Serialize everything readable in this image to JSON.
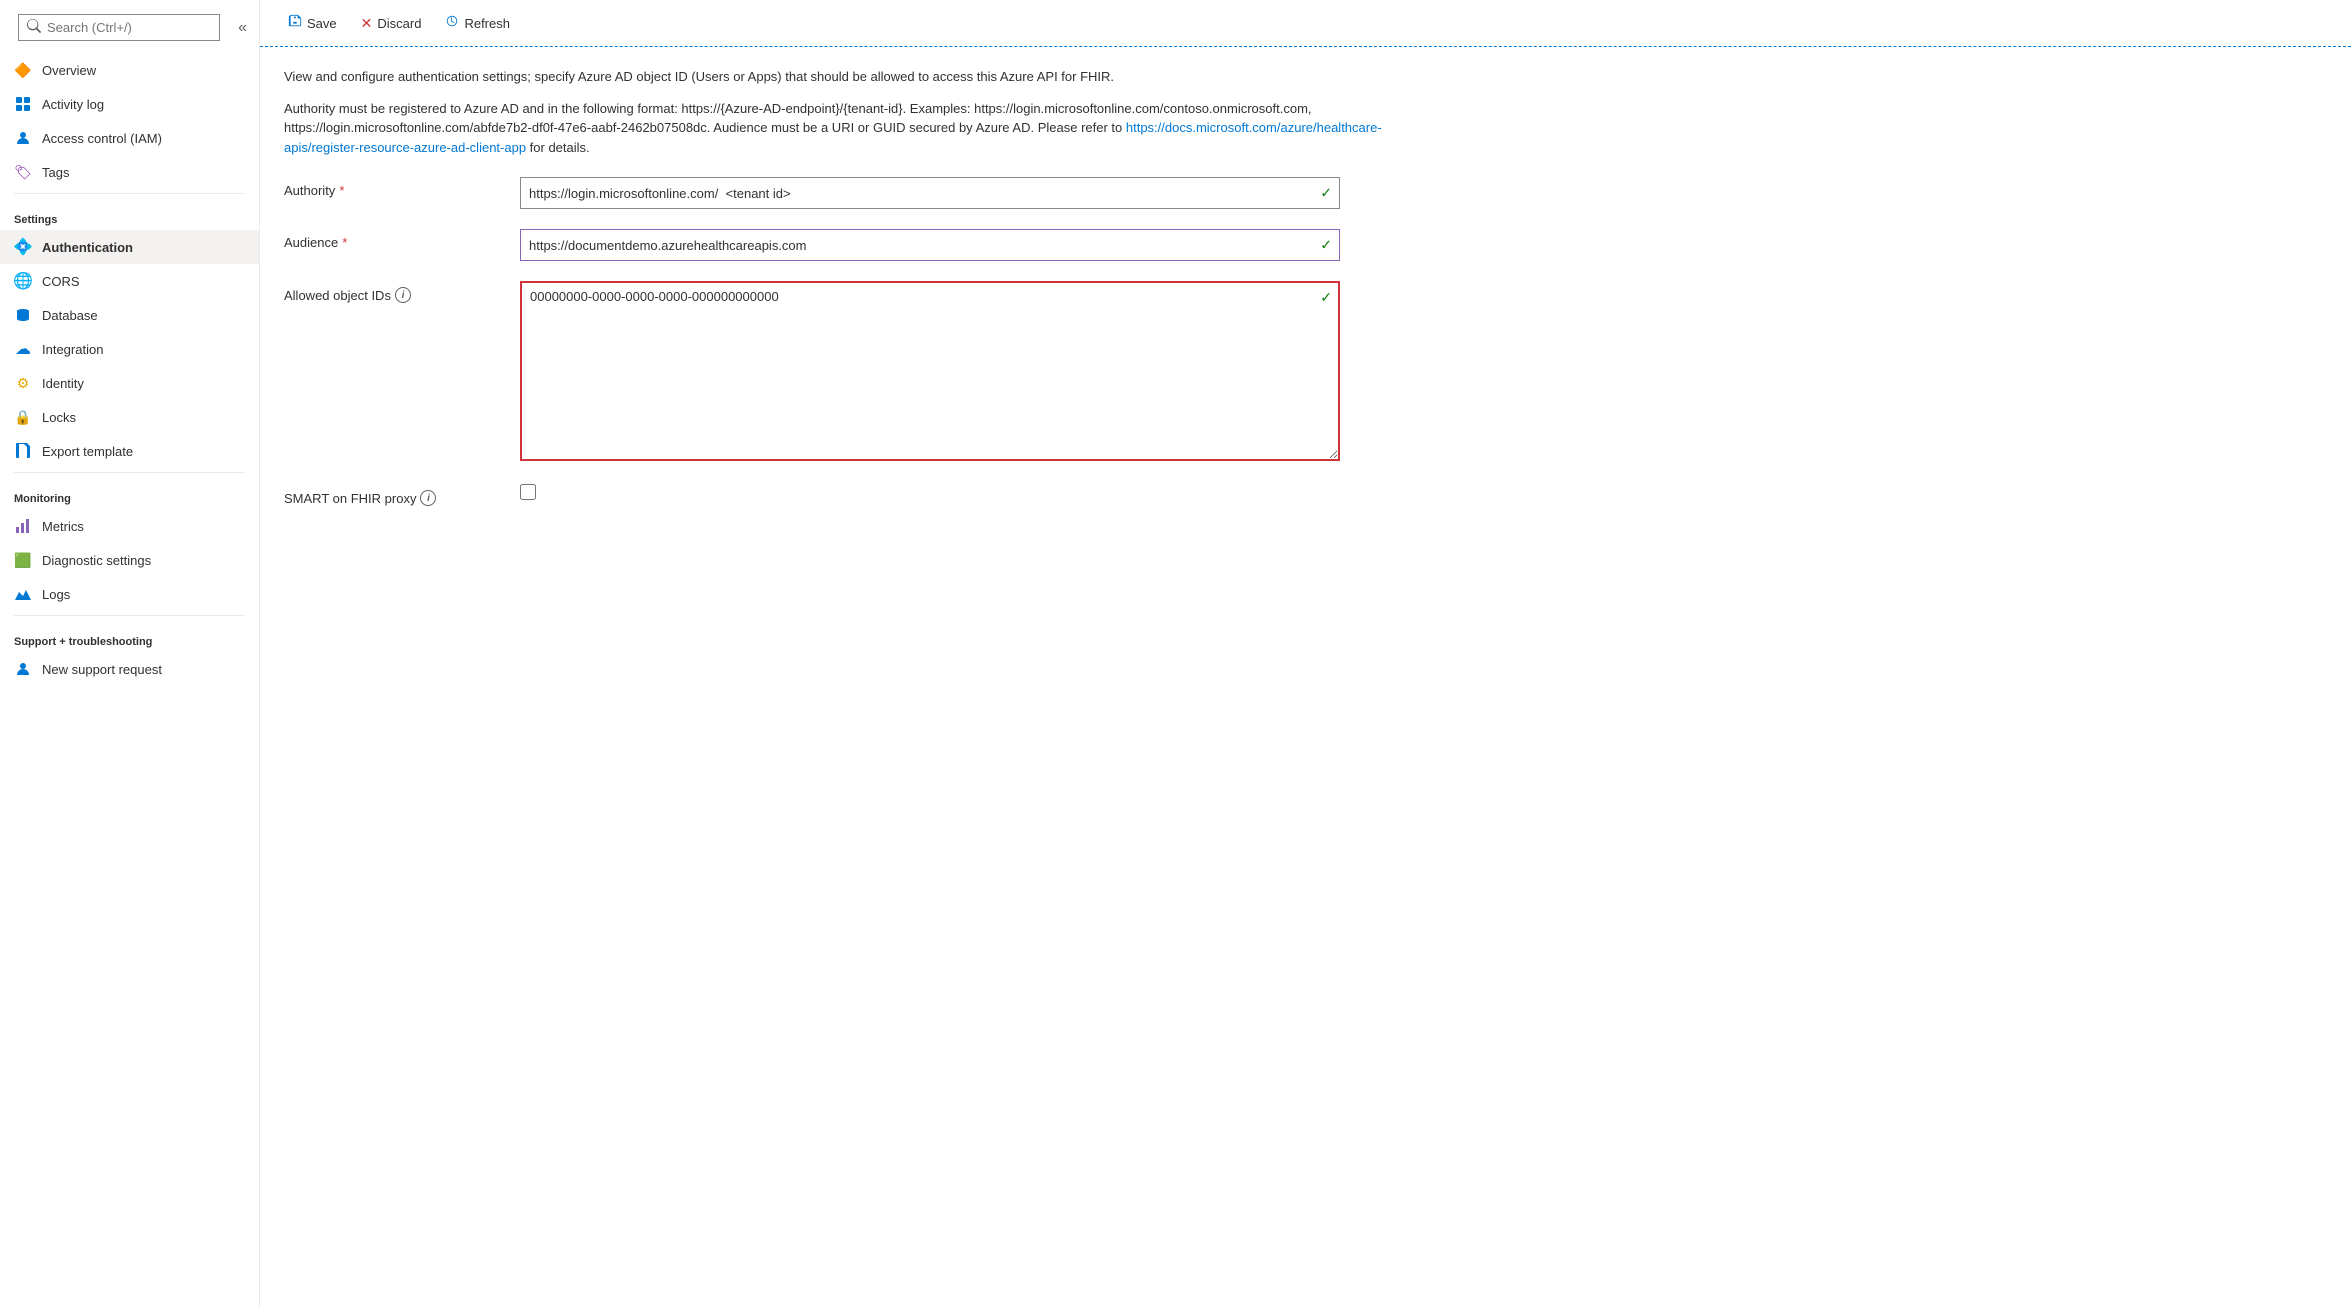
{
  "toolbar": {
    "save_label": "Save",
    "discard_label": "Discard",
    "refresh_label": "Refresh"
  },
  "sidebar": {
    "search_placeholder": "Search (Ctrl+/)",
    "nav_items": [
      {
        "id": "overview",
        "label": "Overview",
        "icon": "🔶",
        "icon_color": "icon-overview"
      },
      {
        "id": "activity-log",
        "label": "Activity log",
        "icon": "🔷",
        "icon_color": "icon-activity"
      },
      {
        "id": "access-control",
        "label": "Access control (IAM)",
        "icon": "👤",
        "icon_color": "icon-access"
      },
      {
        "id": "tags",
        "label": "Tags",
        "icon": "🏷",
        "icon_color": "icon-tags"
      }
    ],
    "settings_header": "Settings",
    "settings_items": [
      {
        "id": "authentication",
        "label": "Authentication",
        "icon": "💠",
        "icon_color": "icon-auth",
        "active": true
      },
      {
        "id": "cors",
        "label": "CORS",
        "icon": "🟢",
        "icon_color": "icon-cors"
      },
      {
        "id": "database",
        "label": "Database",
        "icon": "🔵",
        "icon_color": "icon-database"
      },
      {
        "id": "integration",
        "label": "Integration",
        "icon": "☁",
        "icon_color": "icon-integration"
      },
      {
        "id": "identity",
        "label": "Identity",
        "icon": "⚙",
        "icon_color": "icon-identity"
      },
      {
        "id": "locks",
        "label": "Locks",
        "icon": "🔒",
        "icon_color": "icon-locks"
      },
      {
        "id": "export-template",
        "label": "Export template",
        "icon": "📋",
        "icon_color": "icon-export"
      }
    ],
    "monitoring_header": "Monitoring",
    "monitoring_items": [
      {
        "id": "metrics",
        "label": "Metrics",
        "icon": "📊",
        "icon_color": "icon-metrics"
      },
      {
        "id": "diagnostic",
        "label": "Diagnostic settings",
        "icon": "🟩",
        "icon_color": "icon-diagnostic"
      },
      {
        "id": "logs",
        "label": "Logs",
        "icon": "📈",
        "icon_color": "icon-logs"
      }
    ],
    "support_header": "Support + troubleshooting",
    "support_items": [
      {
        "id": "new-support",
        "label": "New support request",
        "icon": "👤",
        "icon_color": "icon-support"
      }
    ]
  },
  "main": {
    "description1": "View and configure authentication settings; specify Azure AD object ID (Users or Apps) that should be allowed to access this Azure API for FHIR.",
    "description2_part1": "Authority must be registered to Azure AD and in the following format: https://{Azure-AD-endpoint}/{tenant-id}. Examples: https://login.microsoftonline.com/contoso.onmicrosoft.com, https://login.microsoftonline.com/abfde7b2-df0f-47e6-aabf-2462b07508dc. Audience must be a URI or GUID secured by Azure AD. Please refer to ",
    "description2_link_text": "https://docs.microsoft.com/azure/healthcare-apis/register-resource-azure-ad-client-app",
    "description2_link_url": "https://docs.microsoft.com/azure/healthcare-apis/register-resource-azure-ad-client-app",
    "description2_part2": " for details.",
    "authority_label": "Authority",
    "authority_required": "*",
    "authority_value": "https://login.microsoftonline.com/  <tenant id>",
    "audience_label": "Audience",
    "audience_required": "*",
    "audience_value": "https://documentdemo.azurehealthcareapis.com",
    "allowed_ids_label": "Allowed object IDs",
    "allowed_ids_value": "00000000-0000-0000-0000-000000000000",
    "smart_proxy_label": "SMART on FHIR proxy"
  }
}
